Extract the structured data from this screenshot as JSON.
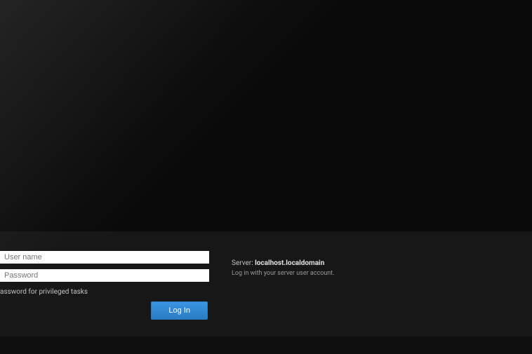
{
  "login": {
    "username_placeholder": "User name",
    "password_placeholder": "Password",
    "privileged_label": "assword for privileged tasks",
    "button_label": "Log In"
  },
  "server": {
    "label": "Server:",
    "hostname": "localhost.localdomain",
    "help_text": "Log in with your server user account."
  }
}
